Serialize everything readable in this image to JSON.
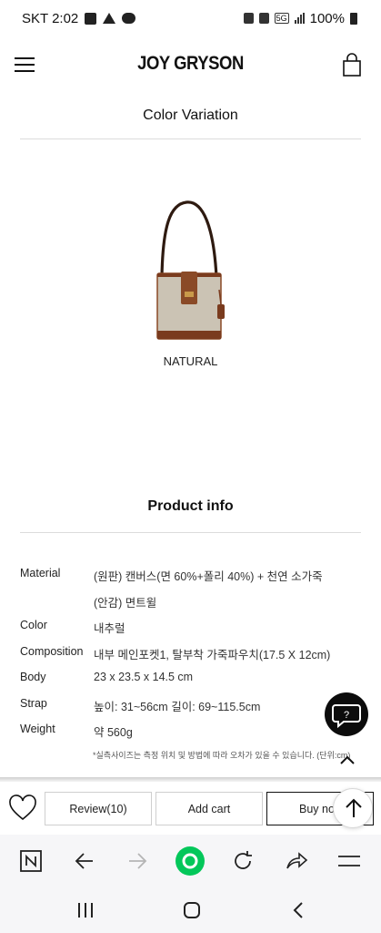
{
  "status_bar": {
    "carrier_time": "SKT 2:02",
    "network": "5G",
    "battery": "100%",
    "icons": [
      "gallery-icon",
      "warning-icon",
      "talk-icon",
      "alarm-icon",
      "mute-icon",
      "signal-icon",
      "battery-icon"
    ]
  },
  "header": {
    "brand": "JOY GRYSON",
    "icons": [
      "menu-icon",
      "shopping-bag-icon"
    ]
  },
  "color_variation": {
    "title": "Color Variation",
    "swatches": [
      {
        "label": "NATURAL",
        "colors": {
          "canvas": "#cbc3b4",
          "leather": "#7a3b1e"
        }
      }
    ]
  },
  "product_info": {
    "title": "Product info",
    "specs": [
      {
        "label": "Material",
        "value": "(원판) 캔버스(면 60%+폴리 40%) + 천연 소가죽"
      },
      {
        "label": "",
        "value": "(안감) 면트윌"
      },
      {
        "label": "Color",
        "value": "내추럴"
      },
      {
        "label": "Composition",
        "value": "내부 메인포켓1, 탈부착 가죽파우치(17.5 X 12cm)"
      },
      {
        "label": "Body",
        "value": "23 x 23.5 x 14.5 cm"
      },
      {
        "label": "Strap",
        "value": "높이: 31~56cm 길이: 69~115.5cm"
      },
      {
        "label": "Weight",
        "value": "약 560g"
      }
    ],
    "note": "*실측사이즈는 측정 위치 및 방법에 따라 오차가 있을 수 있습니다. (단위:cm)"
  },
  "floating": {
    "chat_icon_text": "?",
    "icons": [
      "chat-icon",
      "chevron-up-icon",
      "arrow-up-icon"
    ]
  },
  "actions": {
    "review": "Review(10)",
    "add_cart": "Add cart",
    "buy_now": "Buy now",
    "icons": [
      "heart-icon"
    ]
  },
  "browser_toolbar": {
    "icons": [
      "naver-icon",
      "back-icon",
      "forward-icon",
      "home-icon",
      "refresh-icon",
      "share-icon",
      "menu-icon"
    ],
    "accent": "#03c75a"
  },
  "system_nav": {
    "icons": [
      "recent-apps-icon",
      "home-button-icon",
      "back-button-icon"
    ]
  }
}
